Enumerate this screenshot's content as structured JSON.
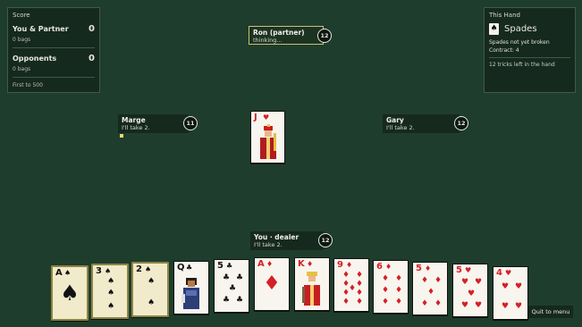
{
  "score": {
    "title": "Score",
    "teams": [
      {
        "name": "You & Partner",
        "points": "0",
        "bags": "0 bags"
      },
      {
        "name": "Opponents",
        "points": "0",
        "bags": "0 bags"
      }
    ],
    "goal": "First to 500"
  },
  "this_hand": {
    "title": "This Hand",
    "trump_suit": "Spades",
    "trump_symbol": "♠",
    "spades_status": "Spades not yet broken",
    "contract": "Contract: 4",
    "tricks_left": "12 tricks left in the hand"
  },
  "seats": {
    "north": {
      "name": "Ron (partner)",
      "status": "thinking...",
      "cards": "12"
    },
    "west": {
      "name": "Marge",
      "status": "I'll take 2.",
      "cards": "11"
    },
    "east": {
      "name": "Gary",
      "status": "I'll take 2.",
      "cards": "12"
    },
    "south": {
      "name": "You  · dealer",
      "status": "I'll take 2.",
      "cards": "12"
    }
  },
  "trick": {
    "played_by_west": {
      "rank": "J",
      "suit": "♥",
      "color": "red"
    }
  },
  "hand": [
    {
      "rank": "A",
      "suit": "♠",
      "color": "black",
      "playable": false
    },
    {
      "rank": "3",
      "suit": "♠",
      "color": "black",
      "playable": false
    },
    {
      "rank": "2",
      "suit": "♠",
      "color": "black",
      "playable": false
    },
    {
      "rank": "Q",
      "suit": "♣",
      "color": "black",
      "playable": true
    },
    {
      "rank": "5",
      "suit": "♣",
      "color": "black",
      "playable": true
    },
    {
      "rank": "A",
      "suit": "♦",
      "color": "red",
      "playable": true
    },
    {
      "rank": "K",
      "suit": "♦",
      "color": "red",
      "playable": true
    },
    {
      "rank": "9",
      "suit": "♦",
      "color": "red",
      "playable": true
    },
    {
      "rank": "6",
      "suit": "♦",
      "color": "red",
      "playable": true
    },
    {
      "rank": "5",
      "suit": "♦",
      "color": "red",
      "playable": true
    },
    {
      "rank": "5",
      "suit": "♥",
      "color": "red",
      "playable": true
    },
    {
      "rank": "4",
      "suit": "♥",
      "color": "red",
      "playable": true
    }
  ],
  "controls": {
    "quit_label": "Quit to menu"
  },
  "colors": {
    "felt": "#1f3d2c",
    "panel": "#15291e",
    "red_suit": "#d42026",
    "highlight": "#e8d870"
  }
}
